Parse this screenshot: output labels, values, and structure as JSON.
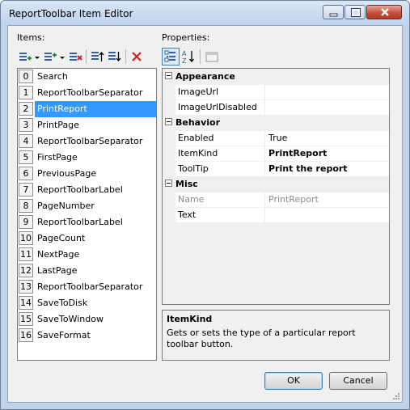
{
  "window": {
    "title": "ReportToolbar Item Editor"
  },
  "items_label": "Items:",
  "properties_label": "Properties:",
  "items": [
    {
      "index": "0",
      "label": "Search"
    },
    {
      "index": "1",
      "label": "ReportToolbarSeparator"
    },
    {
      "index": "2",
      "label": "PrintReport"
    },
    {
      "index": "3",
      "label": "PrintPage"
    },
    {
      "index": "4",
      "label": "ReportToolbarSeparator"
    },
    {
      "index": "5",
      "label": "FirstPage"
    },
    {
      "index": "6",
      "label": "PreviousPage"
    },
    {
      "index": "7",
      "label": "ReportToolbarLabel"
    },
    {
      "index": "8",
      "label": "PageNumber"
    },
    {
      "index": "9",
      "label": "ReportToolbarLabel"
    },
    {
      "index": "10",
      "label": "PageCount"
    },
    {
      "index": "11",
      "label": "NextPage"
    },
    {
      "index": "12",
      "label": "LastPage"
    },
    {
      "index": "13",
      "label": "ReportToolbarSeparator"
    },
    {
      "index": "14",
      "label": "SaveToDisk"
    },
    {
      "index": "15",
      "label": "SaveToWindow"
    },
    {
      "index": "16",
      "label": "SaveFormat"
    }
  ],
  "selected_index": 2,
  "properties": {
    "appearance": {
      "label": "Appearance",
      "rows": [
        {
          "name": "ImageUrl",
          "value": ""
        },
        {
          "name": "ImageUrlDisabled",
          "value": ""
        }
      ]
    },
    "behavior": {
      "label": "Behavior",
      "rows": [
        {
          "name": "Enabled",
          "value": "True"
        },
        {
          "name": "ItemKind",
          "value": "PrintReport"
        },
        {
          "name": "ToolTip",
          "value": "Print the report"
        }
      ]
    },
    "misc": {
      "label": "Misc",
      "rows": [
        {
          "name": "Name",
          "value": "PrintReport"
        },
        {
          "name": "Text",
          "value": ""
        }
      ]
    }
  },
  "description": {
    "title": "ItemKind",
    "text": "Gets or sets the type of a particular report toolbar button."
  },
  "buttons": {
    "ok": "OK",
    "cancel": "Cancel"
  },
  "icons": {
    "items_toolbar": [
      "add-item-icon",
      "dropdown-arrow-icon",
      "insert-item-icon",
      "dropdown-arrow-icon",
      "remove-item-icon",
      "move-up-icon",
      "move-down-icon",
      "delete-icon"
    ],
    "properties_toolbar": [
      "categorized-icon",
      "alphabetical-icon",
      "property-pages-icon"
    ]
  },
  "colors": {
    "selection": "#3399ff",
    "titlebar": "#bcd1eb",
    "delete": "#d22020"
  }
}
